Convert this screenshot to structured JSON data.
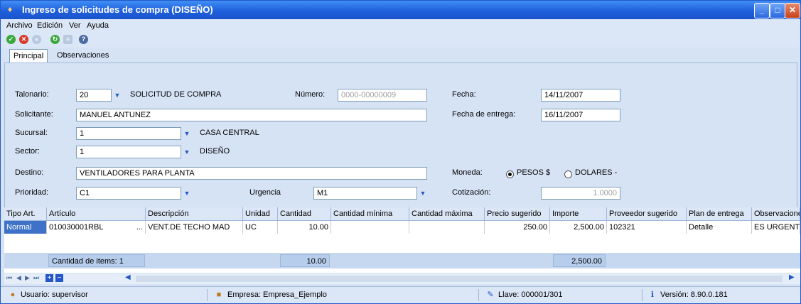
{
  "window": {
    "title": "Ingreso de solicitudes de compra (DISEÑO)"
  },
  "menu": [
    "Archivo",
    "Edición",
    "Ver",
    "Ayuda"
  ],
  "tabs": [
    "Principal",
    "Observaciones"
  ],
  "form": {
    "talonario_label": "Talonario:",
    "talonario_value": "20",
    "talonario_desc": "SOLICITUD DE COMPRA",
    "numero_label": "Número:",
    "numero_value": "0000-00000009",
    "fecha_label": "Fecha:",
    "fecha_value": "14/11/2007",
    "solicitante_label": "Solicitante:",
    "solicitante_value": "MANUEL ANTUNEZ",
    "fecha_entrega_label": "Fecha de entrega:",
    "fecha_entrega_value": "16/11/2007",
    "sucursal_label": "Sucursal:",
    "sucursal_value": "1",
    "sucursal_desc": "CASA CENTRAL",
    "sector_label": "Sector:",
    "sector_value": "1",
    "sector_desc": "DISEÑO",
    "destino_label": "Destino:",
    "destino_value": "VENTILADORES PARA PLANTA",
    "moneda_label": "Moneda:",
    "moneda_opt1": "PESOS $",
    "moneda_opt2": "DOLARES -",
    "prioridad_label": "Prioridad:",
    "prioridad_value": "C1",
    "urgencia_label": "Urgencia",
    "urgencia_value": "M1",
    "cotizacion_label": "Cotización:",
    "cotizacion_value": "1.0000"
  },
  "grid": {
    "headers": [
      "Tipo Art.",
      "Artículo",
      "Descripción",
      "Unidad",
      "Cantidad",
      "Cantidad mínima",
      "Cantidad máxima",
      "Precio sugerido",
      "Importe",
      "Proveedor sugerido",
      "Plan de entrega",
      "Observaciones"
    ],
    "row": [
      "Normal",
      "010030001RBL",
      "VENT.DE TECHO MAD",
      "UC",
      "10.00",
      "",
      "",
      "250.00",
      "2,500.00",
      "102321",
      "Detalle",
      "ES URGENTE"
    ],
    "dots": "..."
  },
  "totals": {
    "items": "Cantidad de items: 1",
    "cantidad": "10.00",
    "importe": "2,500.00"
  },
  "status": {
    "usuario": "Usuario: supervisor",
    "empresa_label": "Empresa:",
    "empresa_value": "Empresa_Ejemplo",
    "llave": "Llave: 000001/301",
    "version": "Versión: 8.90.0.181"
  }
}
